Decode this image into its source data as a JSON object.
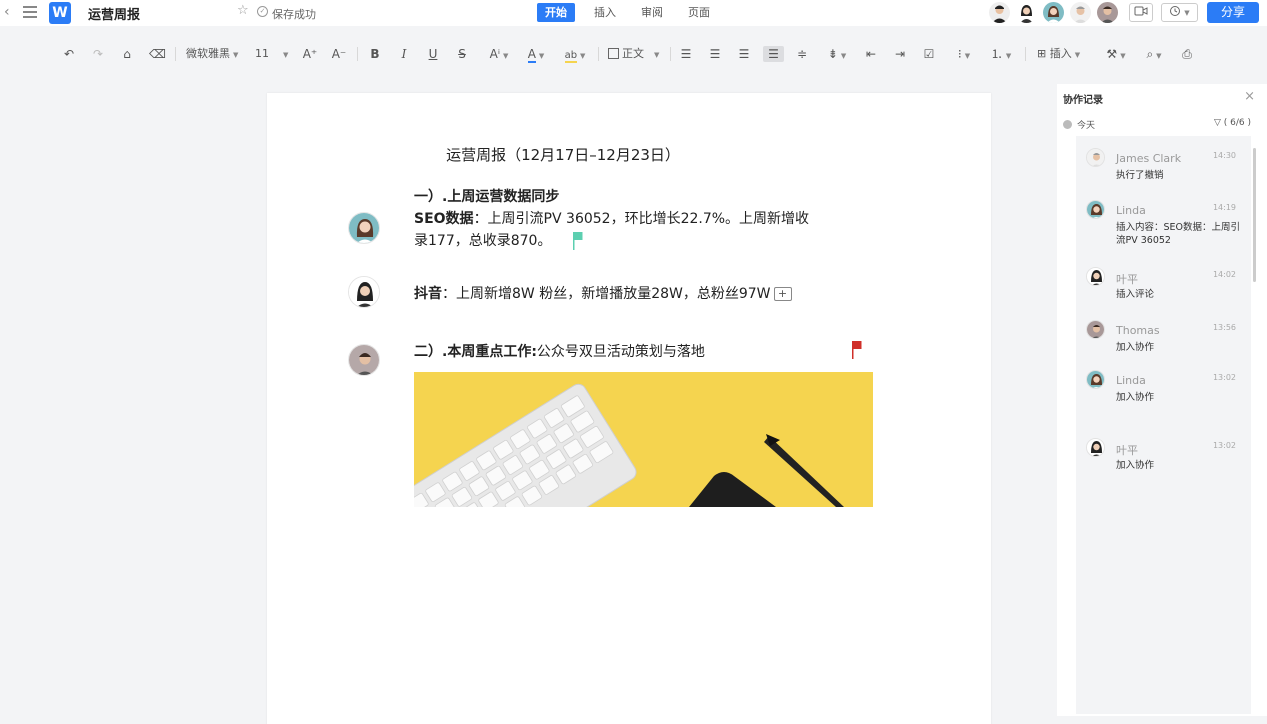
{
  "topbar": {
    "back_icon": "chevron-left-icon",
    "menu_icon": "hamburger-menu-icon",
    "logo_letter": "W",
    "doc_title": "运营周报",
    "save_status": "保存成功",
    "tabs": [
      {
        "label": "开始",
        "active": true
      },
      {
        "label": "插入",
        "active": false
      },
      {
        "label": "审阅",
        "active": false
      },
      {
        "label": "页面",
        "active": false
      }
    ],
    "share_label": "分享",
    "accent_color": "#2b7cf6"
  },
  "toolbar": {
    "font_name": "微软雅黑",
    "font_size": "11",
    "font_size_up": "A⁺",
    "font_size_down": "A⁻",
    "bold": "B",
    "italic": "I",
    "underline": "U",
    "strike": "S",
    "style_name": "正文",
    "insert_label": "插入"
  },
  "document": {
    "title": "运营周报（12月17日–12月23日）",
    "section1_heading": "一）.上周运营数据同步",
    "seo_label": "SEO数据",
    "seo_text_line1": "：上周引流PV 36052，环比增长22.7%。上周新增收",
    "seo_text_line2": "录177，总收录870。",
    "douyin_label": "抖音",
    "douyin_text": "：上周新增8W 粉丝，新增播放量28W，总粉丝97W",
    "comment_plus": "+",
    "section2_heading": "二）.本周重点工作:",
    "section2_text": "公众号双旦活动策划与落地"
  },
  "sidebar": {
    "title": "协作记录",
    "day_label": "今天",
    "filter_label": "( 6/6 )",
    "entries": [
      {
        "name": "James Clark",
        "time": "14:30",
        "text": "执行了撤销"
      },
      {
        "name": "Linda",
        "time": "14:19",
        "text": "插入内容：SEO数据：上周引流PV 36052"
      },
      {
        "name": "叶平",
        "time": "14:02",
        "text": "插入评论"
      },
      {
        "name": "Thomas",
        "time": "13:56",
        "text": "加入协作"
      },
      {
        "name": "Linda",
        "time": "13:02",
        "text": "加入协作"
      },
      {
        "name": "叶平",
        "time": "13:02",
        "text": "加入协作"
      }
    ]
  }
}
